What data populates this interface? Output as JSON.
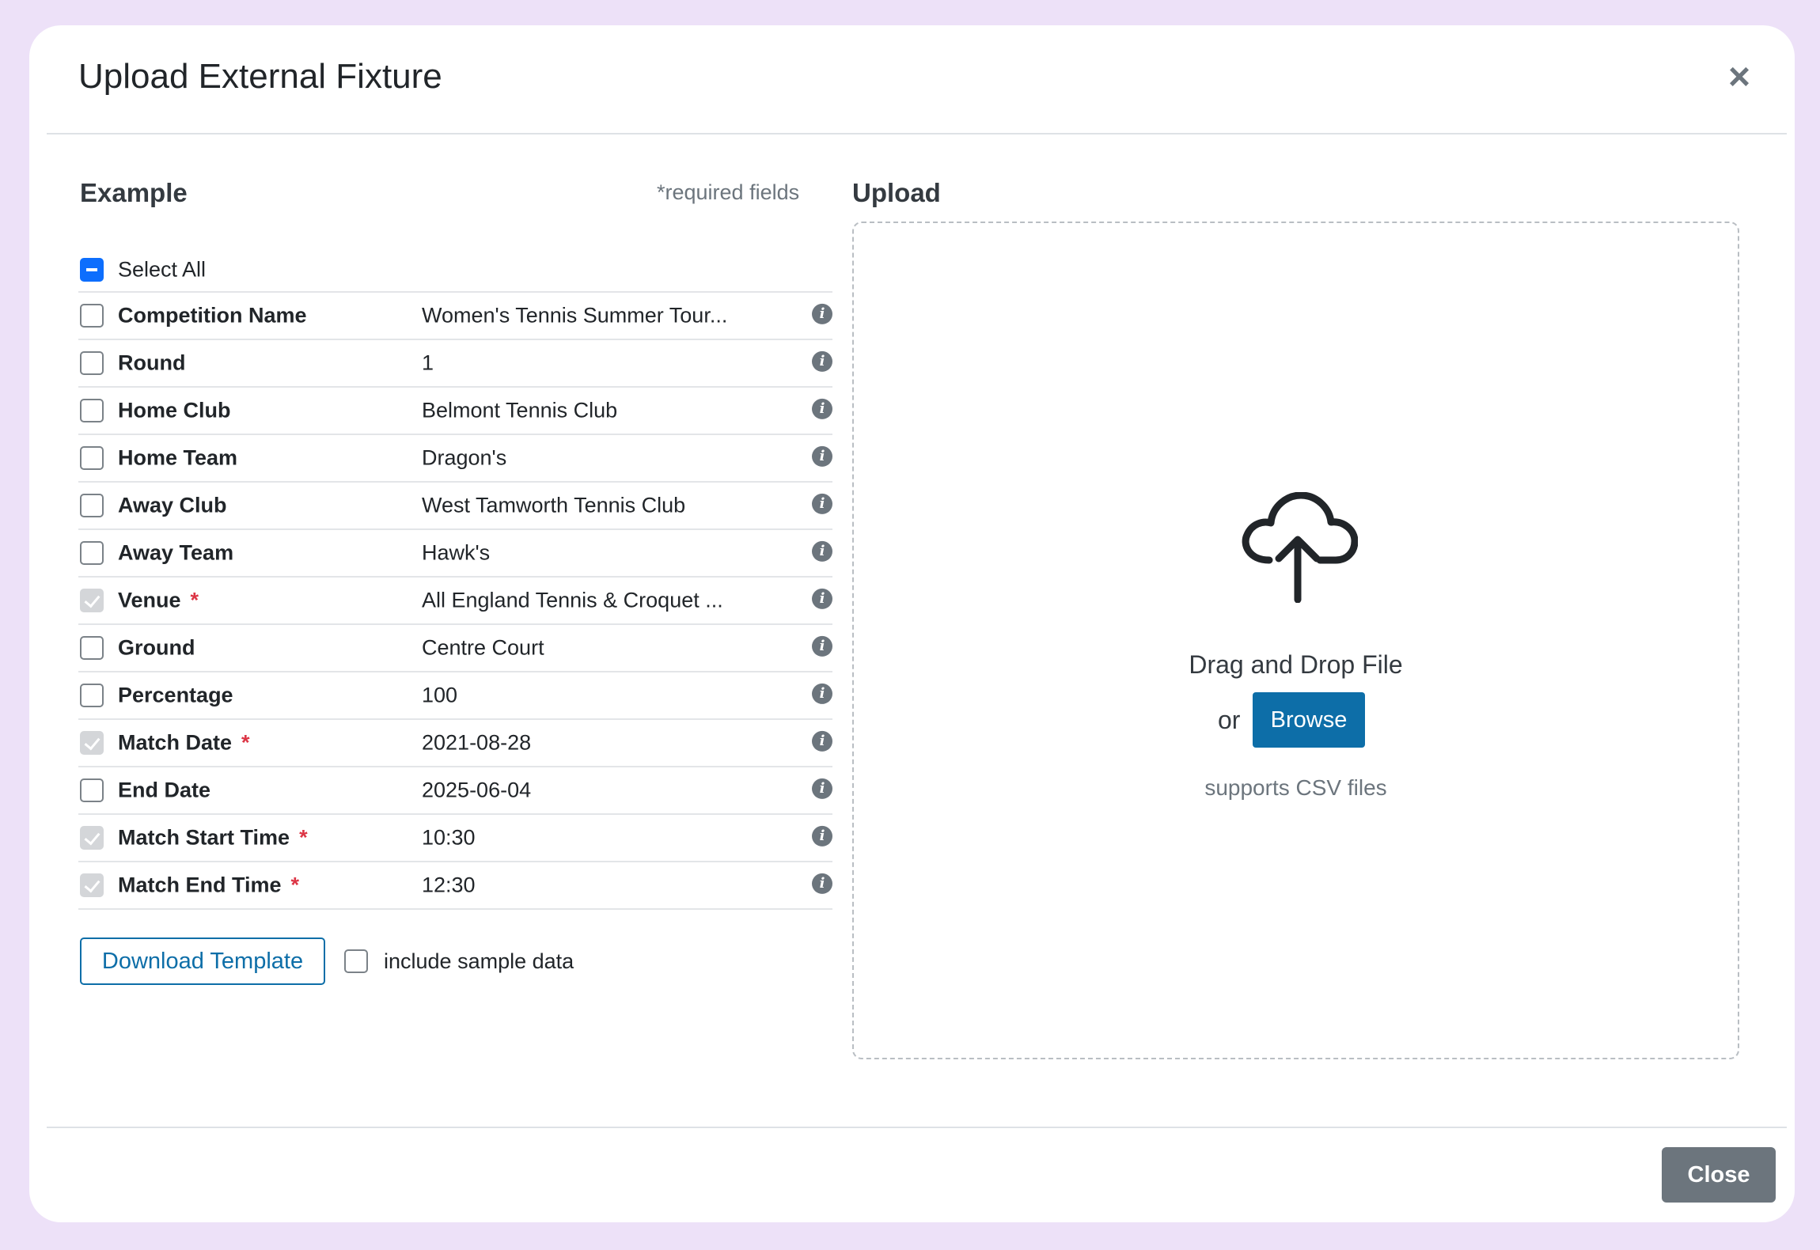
{
  "modal": {
    "title": "Upload External Fixture",
    "close_icon": "close-icon"
  },
  "example": {
    "title": "Example",
    "required_note": "*required fields",
    "select_all_label": "Select All",
    "fields": [
      {
        "label": "Competition Name",
        "value": "Women's Tennis Summer Tour...",
        "required": false,
        "checked": false
      },
      {
        "label": "Round",
        "value": "1",
        "required": false,
        "checked": false
      },
      {
        "label": "Home Club",
        "value": "Belmont Tennis Club",
        "required": false,
        "checked": false
      },
      {
        "label": "Home Team",
        "value": "Dragon's",
        "required": false,
        "checked": false
      },
      {
        "label": "Away Club",
        "value": "West Tamworth Tennis Club",
        "required": false,
        "checked": false
      },
      {
        "label": "Away Team",
        "value": "Hawk's",
        "required": false,
        "checked": false
      },
      {
        "label": "Venue",
        "value": "All England Tennis & Croquet ...",
        "required": true,
        "checked": true
      },
      {
        "label": "Ground",
        "value": "Centre Court",
        "required": false,
        "checked": false
      },
      {
        "label": "Percentage",
        "value": "100",
        "required": false,
        "checked": false
      },
      {
        "label": "Match Date",
        "value": "2021-08-28",
        "required": true,
        "checked": true
      },
      {
        "label": "End Date",
        "value": "2025-06-04",
        "required": false,
        "checked": false
      },
      {
        "label": "Match Start Time",
        "value": "10:30",
        "required": true,
        "checked": true
      },
      {
        "label": "Match End Time",
        "value": "12:30",
        "required": true,
        "checked": true
      }
    ],
    "required_marker": "*",
    "info_glyph": "i",
    "download_button": "Download Template",
    "sample_data_label": "include sample data"
  },
  "upload": {
    "title": "Upload",
    "drag_text": "Drag and Drop File",
    "or_text": "or",
    "browse_button": "Browse",
    "support_text": "supports CSV files",
    "icon": "cloud-upload-icon"
  },
  "footer": {
    "close_button": "Close"
  },
  "colors": {
    "backdrop": "#ede1f8",
    "primary": "#0d6ea8",
    "required": "#dc3545",
    "secondary": "#6c757d"
  }
}
